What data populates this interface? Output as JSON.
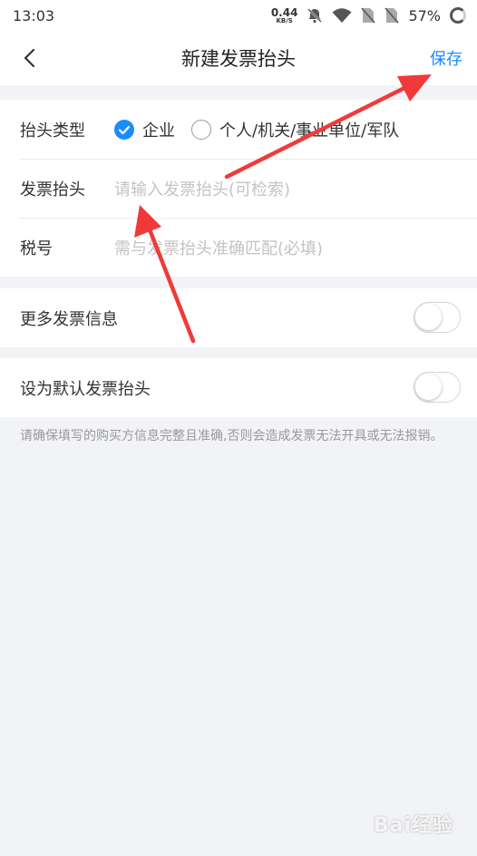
{
  "status": {
    "time": "13:03",
    "net_speed_value": "0.44",
    "net_speed_unit": "KB/S",
    "battery": "57%"
  },
  "nav": {
    "title": "新建发票抬头",
    "save_label": "保存"
  },
  "form": {
    "type_label": "抬头类型",
    "type_options": [
      {
        "label": "企业",
        "selected": true
      },
      {
        "label": "个人/机关/事业单位/军队",
        "selected": false
      }
    ],
    "title_label": "发票抬头",
    "title_placeholder": "请输入发票抬头(可检索)",
    "tax_label": "税号",
    "tax_placeholder": "需与发票抬头准确匹配(必填)"
  },
  "more_info": {
    "label": "更多发票信息",
    "enabled": false
  },
  "default_title": {
    "label": "设为默认发票抬头",
    "enabled": false
  },
  "note": "请确保填写的购买方信息完整且准确,否则会造成发票无法开具或无法报销。",
  "watermark": "Bai经验",
  "colors": {
    "accent": "#1a8cff",
    "annotation_arrow": "#f03a3a"
  }
}
